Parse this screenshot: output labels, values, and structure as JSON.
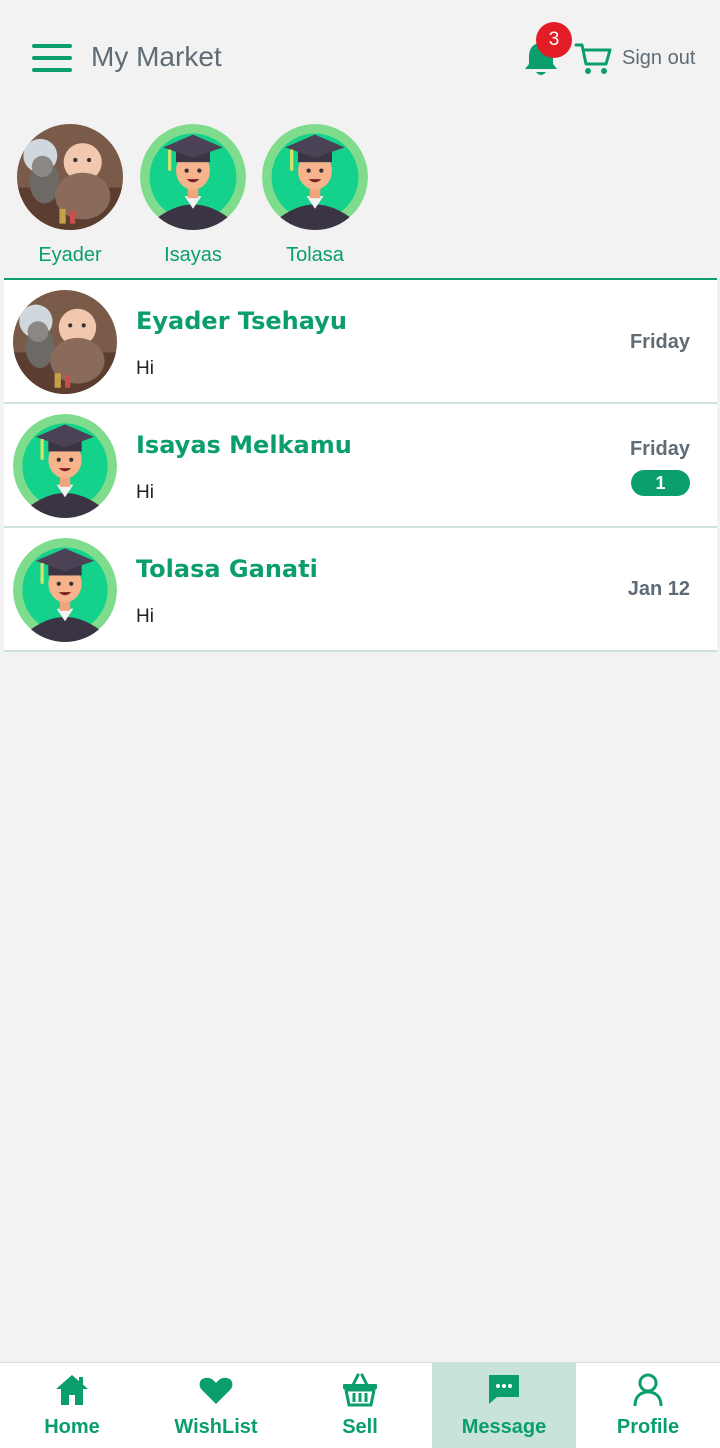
{
  "header": {
    "title": "My Market",
    "notification_count": "3",
    "signout_label": "Sign out",
    "accent_color": "#0a9e6e"
  },
  "stories": [
    {
      "name": "Eyader",
      "avatar": "photo"
    },
    {
      "name": "Isayas",
      "avatar": "graduate"
    },
    {
      "name": "Tolasa",
      "avatar": "graduate"
    }
  ],
  "chats": [
    {
      "name": "Eyader Tsehayu",
      "last_message": "Hi",
      "date": "Friday",
      "unread": null,
      "avatar": "photo"
    },
    {
      "name": "Isayas Melkamu",
      "last_message": "Hi",
      "date": "Friday",
      "unread": "1",
      "avatar": "graduate"
    },
    {
      "name": "Tolasa Ganati",
      "last_message": "Hi",
      "date": "Jan 12",
      "unread": null,
      "avatar": "graduate"
    }
  ],
  "bottom_nav": [
    {
      "label": "Home",
      "icon": "home-icon",
      "active": false
    },
    {
      "label": "WishList",
      "icon": "heart-icon",
      "active": false
    },
    {
      "label": "Sell",
      "icon": "basket-icon",
      "active": false
    },
    {
      "label": "Message",
      "icon": "chat-icon",
      "active": true
    },
    {
      "label": "Profile",
      "icon": "user-icon",
      "active": false
    }
  ]
}
